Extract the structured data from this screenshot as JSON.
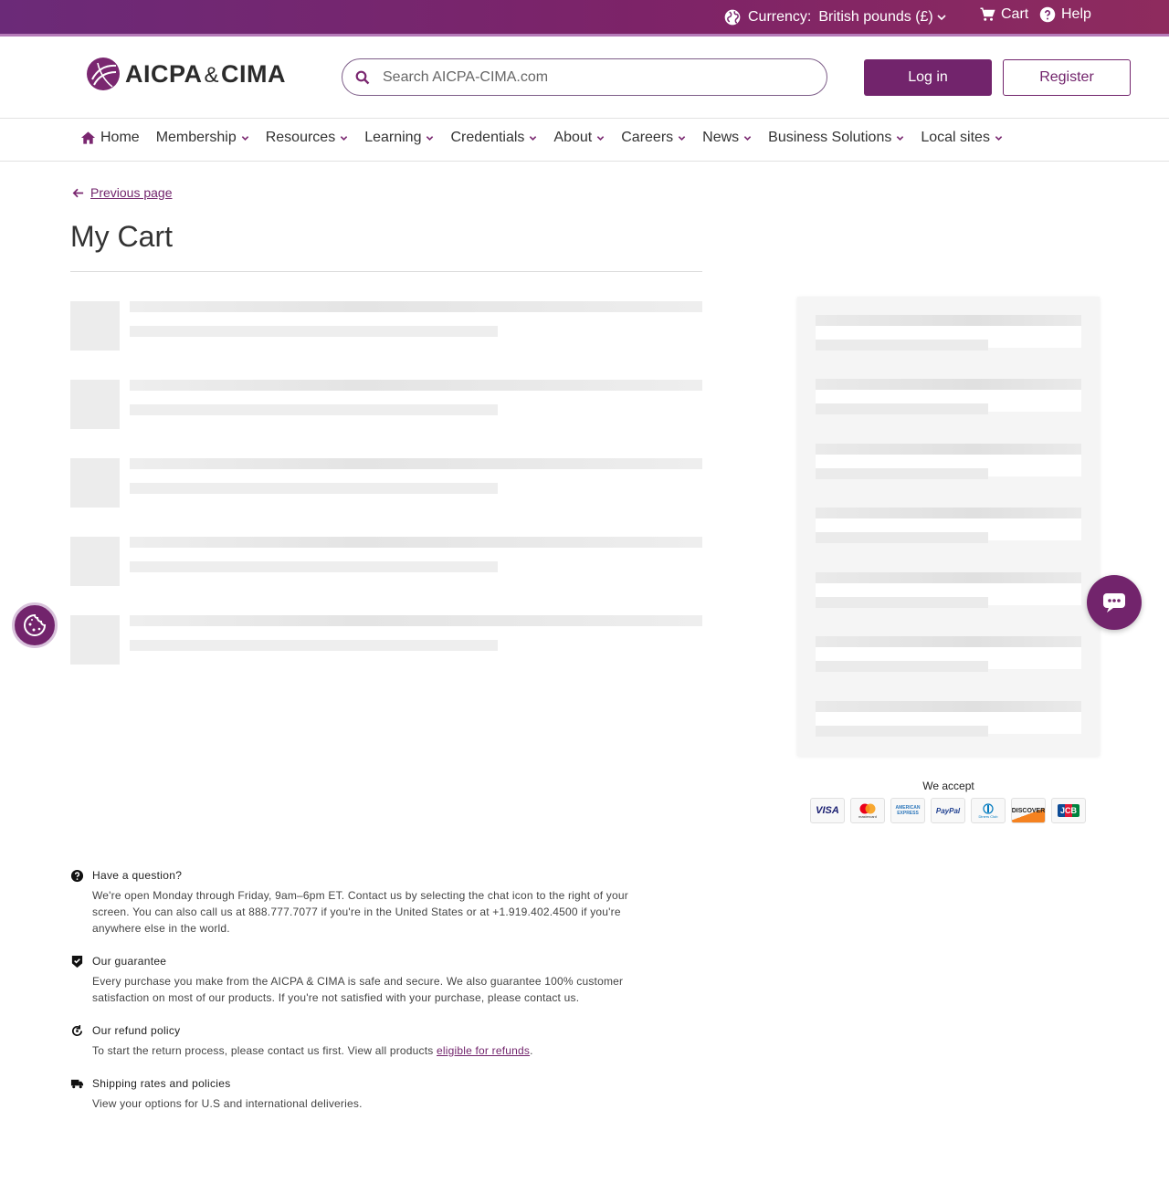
{
  "topbar": {
    "currency_label": "Currency:",
    "currency_value": "British pounds (£)",
    "cart_label": "Cart",
    "help_label": "Help"
  },
  "header": {
    "logo_text_left": "AICPA",
    "logo_amp": "&",
    "logo_text_right": "CIMA",
    "search_placeholder": "Search AICPA-CIMA.com",
    "login_label": "Log in",
    "register_label": "Register"
  },
  "nav": {
    "items": [
      "Home",
      "Membership",
      "Resources",
      "Learning",
      "Credentials",
      "About",
      "Careers",
      "News",
      "Business Solutions",
      "Local sites"
    ]
  },
  "page": {
    "previous_label": "Previous page",
    "title": "My Cart"
  },
  "payment": {
    "accept_label": "We accept",
    "cards": [
      "VISA",
      "mastercard",
      "AMERICAN EXPRESS",
      "PayPal",
      "Diners Club",
      "DISCOVER",
      "JCB"
    ]
  },
  "info": {
    "question_head": "Have a question?",
    "question_body": "We're open Monday through Friday, 9am–6pm ET. Contact us by selecting the chat icon to the right of your screen. You can also call us at 888.777.7077 if you're in the United States or at +1.919.402.4500 if you're anywhere else in the world.",
    "guarantee_head": "Our guarantee",
    "guarantee_body": "Every purchase you make from the AICPA & CIMA is safe and secure. We also guarantee 100% customer satisfaction on most of our products. If you're not satisfied with your purchase, please contact us.",
    "refund_head": "Our refund policy",
    "refund_body": "To start the return process, please contact us first. View all products",
    "refund_link": "eligible for refunds",
    "refund_end": ".",
    "shipping_head": "Shipping rates and policies",
    "shipping_body": "View your options for U.S and international deliveries."
  },
  "colors": {
    "brand": "#72246c",
    "topbar_start": "#6b2a78",
    "topbar_end": "#8e2b5e"
  }
}
